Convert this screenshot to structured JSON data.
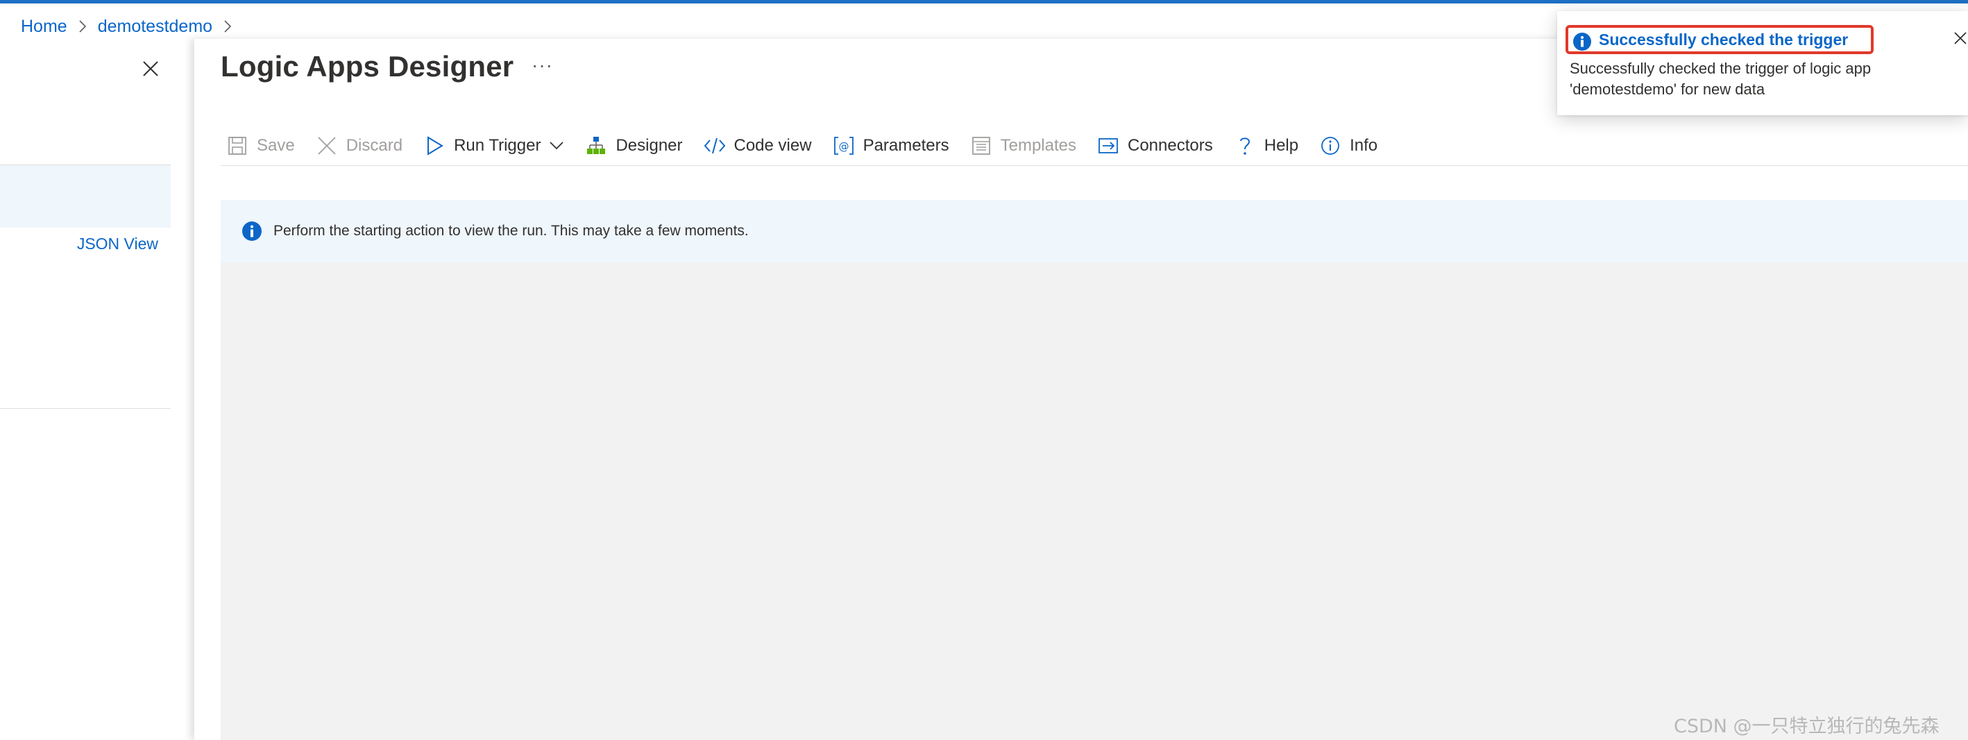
{
  "breadcrumb": {
    "items": [
      {
        "label": "Home"
      },
      {
        "label": "demotestdemo"
      }
    ]
  },
  "left_pane": {
    "json_view_label": "JSON View"
  },
  "designer": {
    "title": "Logic Apps Designer",
    "more_label": "···",
    "toolbar": {
      "save": "Save",
      "discard": "Discard",
      "run_trigger": "Run Trigger",
      "designer": "Designer",
      "code_view": "Code view",
      "parameters": "Parameters",
      "templates": "Templates",
      "connectors": "Connectors",
      "help": "Help",
      "info": "Info"
    },
    "info_message": "Perform the starting action to view the run. This may take a few moments."
  },
  "notification": {
    "title": "Successfully checked the trigger",
    "body": "Successfully checked the trigger of logic app 'demotestdemo' for new data"
  },
  "watermark": "CSDN @一只特立独行的兔先森",
  "colors": {
    "accent": "#0b66c8",
    "highlight_border": "#e0392b",
    "info_bg": "#eff6fc",
    "canvas_bg": "#f2f2f2",
    "top_bar": "#1f6fc4"
  },
  "icons": {
    "save": "save-icon",
    "discard": "discard-icon",
    "run_trigger": "play-icon",
    "designer": "designer-icon",
    "code_view": "code-icon",
    "parameters": "parameters-icon",
    "templates": "templates-icon",
    "connectors": "connectors-icon",
    "help": "help-icon",
    "info": "info-icon"
  }
}
